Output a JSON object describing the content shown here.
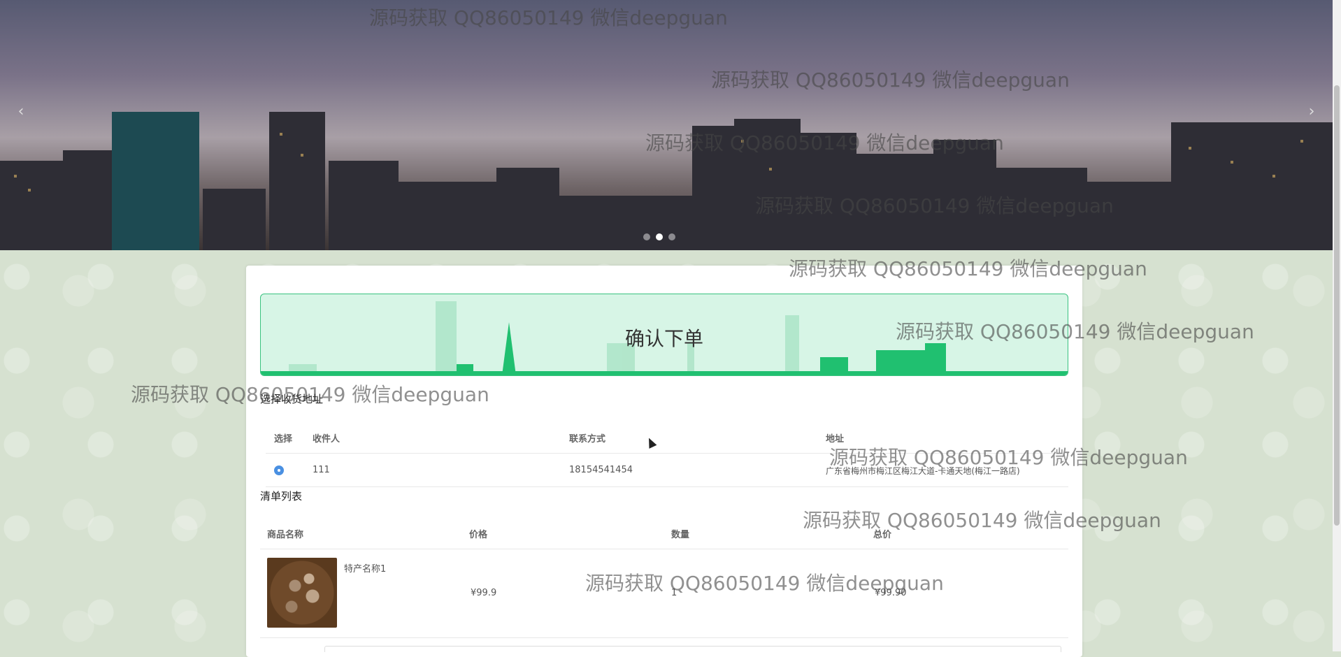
{
  "banner": {
    "prev_arrow": "‹",
    "next_arrow": "›",
    "dot_count": 3,
    "active_dot": 1
  },
  "page": {
    "title": "确认下单"
  },
  "address": {
    "section_title": "选择收货地址",
    "headers": [
      "选择",
      "收件人",
      "联系方式",
      "地址"
    ],
    "rows": [
      {
        "selected": true,
        "recipient": "111",
        "phone": "18154541454",
        "address": "广东省梅州市梅江区梅江大道-卡通天地(梅江一路店)"
      }
    ]
  },
  "cart": {
    "section_title": "清单列表",
    "headers": [
      "商品名称",
      "价格",
      "数量",
      "总价"
    ],
    "items": [
      {
        "name": "特产名称1",
        "price": "¥99.9",
        "quantity": "1",
        "total": "¥99.90"
      }
    ]
  },
  "watermarks": [
    "源码获取 QQ86050149 微信deepguan",
    "源码获取 QQ86050149 微信deepguan",
    "源码获取 QQ86050149 微信deepguan",
    "源码获取 QQ86050149 微信deepguan",
    "源码获取 QQ86050149 微信deepguan",
    "源码获取 QQ86050149 微信deepguan",
    "源码获取 QQ86050149 微信deepguan",
    "源码获取 QQ86050149 微信deepguan",
    "源码获取 QQ86050149 微信deepguan",
    "源码获取 QQ86050149 微信deepguan"
  ],
  "colors": {
    "accent": "#39c27f",
    "title_bg": "#d7f5e6",
    "page_bg": "#d6e1d0"
  }
}
